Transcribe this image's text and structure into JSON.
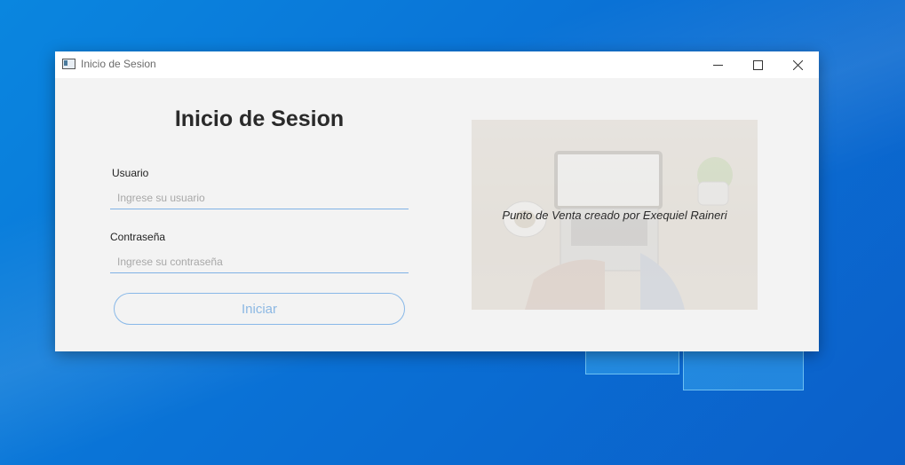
{
  "window": {
    "title": "Inicio de Sesion",
    "controls": {
      "minimize": "minimize-icon",
      "maximize": "maximize-icon",
      "close": "close-icon"
    }
  },
  "form": {
    "heading": "Inicio de Sesion",
    "username": {
      "label": "Usuario",
      "value": "",
      "placeholder": "Ingrese su usuario"
    },
    "password": {
      "label": "Contraseña",
      "value": "",
      "placeholder": "Ingrese su contraseña"
    },
    "submit_label": "Iniciar"
  },
  "promo": {
    "caption": "Punto de Venta creado por Exequiel Raineri",
    "image": "laptop-desk-photo"
  },
  "colors": {
    "accent": "#7fb2e5",
    "window_bg": "#f3f3f3",
    "desktop_bg": "#0a72d6"
  }
}
